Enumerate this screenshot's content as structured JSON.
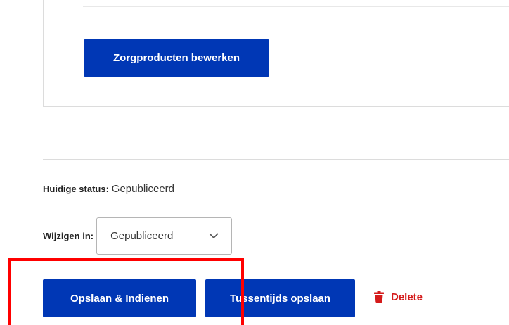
{
  "card": {
    "edit_products_label": "Zorgproducten bewerken"
  },
  "status": {
    "label": "Huidige status:",
    "value": "Gepubliceerd"
  },
  "change": {
    "label": "Wijzigen in:",
    "selected": "Gepubliceerd"
  },
  "actions": {
    "submit_label": "Opslaan & Indienen",
    "save_draft_label": "Tussentijds opslaan",
    "delete_label": "Delete"
  },
  "colors": {
    "primary": "#0037b5",
    "danger": "#d41a1a",
    "highlight": "#ff0000"
  },
  "icons": {
    "select_arrow": "chevron-down-icon",
    "delete": "trash-icon"
  }
}
